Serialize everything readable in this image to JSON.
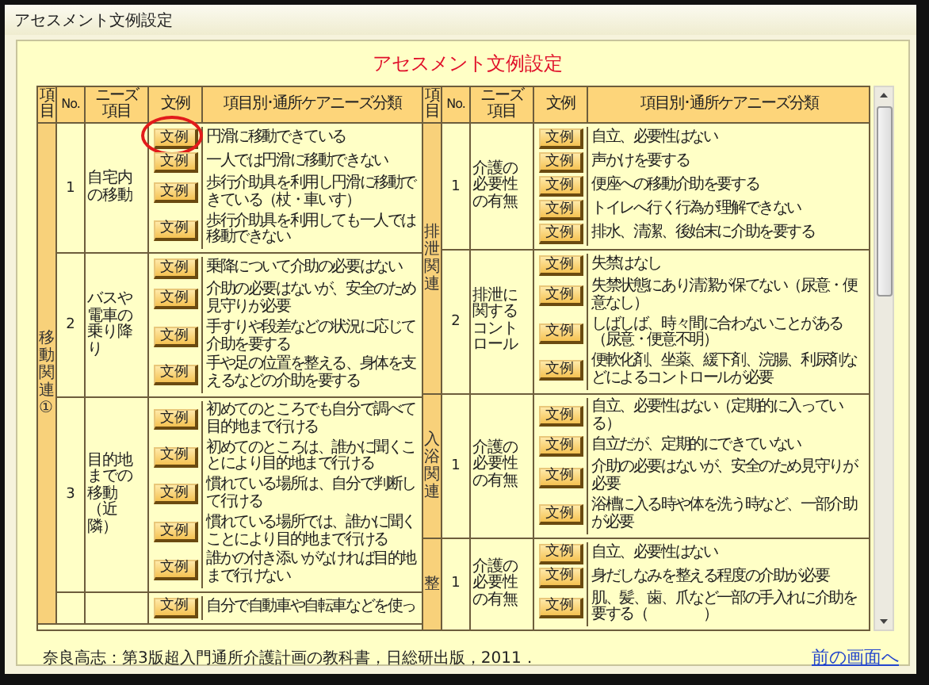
{
  "window": {
    "title": "アセスメント文例設定"
  },
  "heading": "アセスメント文例設定",
  "header_left": [
    "項目",
    "No.",
    "ニーズ項目",
    "文例",
    "項目別･通所ケアニーズ分類"
  ],
  "header_right": [
    "項目",
    "No.",
    "ニーズ項目",
    "文例",
    "項目別･通所ケアニーズ分類"
  ],
  "left": [
    {
      "label": "移動関連①",
      "groups": [
        {
          "no": "1",
          "need": "自宅内の移動",
          "items": [
            {
              "button": "文例",
              "text": "円滑に移動できている",
              "circled": true
            },
            {
              "button": "文例",
              "text": "一人では円滑に移動できない",
              "circled": false
            },
            {
              "button": "文例",
              "text": "歩行介助具を利用し円滑に移動できている（杖・車いす）",
              "circled": false
            },
            {
              "button": "文例",
              "text": "歩行介助具を利用しても一人では移動できない",
              "circled": false
            }
          ]
        },
        {
          "no": "2",
          "need": "バスや電車の乗り降り",
          "items": [
            {
              "button": "文例",
              "text": "乗降について介助の必要はない",
              "circled": false
            },
            {
              "button": "文例",
              "text": "介助の必要はないが、安全のため見守りが必要",
              "circled": false
            },
            {
              "button": "文例",
              "text": "手すりや段差などの状況に応じて介助を要する",
              "circled": false
            },
            {
              "button": "文例",
              "text": "手や足の位置を整える、身体を支えるなどの介助を要する",
              "circled": false
            }
          ]
        },
        {
          "no": "3",
          "need": "目的地までの移動（近隣）",
          "items": [
            {
              "button": "文例",
              "text": "初めてのところでも自分で調べて目的地まで行ける",
              "circled": false
            },
            {
              "button": "文例",
              "text": "初めてのところは、誰かに聞くことにより目的地まで行ける",
              "circled": false
            },
            {
              "button": "文例",
              "text": "慣れている場所は、自分で判断して行ける",
              "circled": false
            },
            {
              "button": "文例",
              "text": "慣れている場所では、誰かに聞くことにより目的地まで行ける",
              "circled": false
            },
            {
              "button": "文例",
              "text": "誰かの付き添いがなければ目的地まで行けない",
              "circled": false
            }
          ]
        },
        {
          "items": [
            {
              "button": "文例",
              "text": "自分で自動車や自転車などを使っ",
              "circled": false
            }
          ]
        }
      ]
    }
  ],
  "right": [
    {
      "label": "排泄関連",
      "groups": [
        {
          "no": "1",
          "need": "介護の必要性の有無",
          "items": [
            {
              "button": "文例",
              "text": "自立、必要性はない",
              "circled": false
            },
            {
              "button": "文例",
              "text": "声かけを要する",
              "circled": false
            },
            {
              "button": "文例",
              "text": "便座への移動介助を要する",
              "circled": false
            },
            {
              "button": "文例",
              "text": "トイレへ行く行為が理解できない",
              "circled": false
            },
            {
              "button": "文例",
              "text": "排水、清潔、後始末に介助を要する",
              "circled": false
            }
          ]
        },
        {
          "no": "2",
          "need": "排泄に関するコントロール",
          "items": [
            {
              "button": "文例",
              "text": "失禁はなし",
              "circled": false
            },
            {
              "button": "文例",
              "text": "失禁状態にあり清潔が保てない（尿意・便意なし）",
              "circled": false
            },
            {
              "button": "文例",
              "text": "しばしば、時々間に合わないことがある（尿意・便意不明）",
              "circled": false
            },
            {
              "button": "文例",
              "text": "便軟化剤、坐薬、緩下剤、浣腸、利尿剤などによるコントロールが必要",
              "circled": false
            }
          ]
        }
      ]
    },
    {
      "label": "入浴関連",
      "groups": [
        {
          "no": "1",
          "need": "介護の必要性の有無",
          "items": [
            {
              "button": "文例",
              "text": "自立、必要性はない（定期的に入っている）",
              "circled": false
            },
            {
              "button": "文例",
              "text": "自立だが、定期的にできていない",
              "circled": false
            },
            {
              "button": "文例",
              "text": "介助の必要はないが、安全のため見守りが必要",
              "circled": false
            },
            {
              "button": "文例",
              "text": "浴槽に入る時や体を洗う時など、一部介助が必要",
              "circled": false
            }
          ]
        }
      ]
    },
    {
      "label": "整",
      "groups": [
        {
          "no": "1",
          "need": "介護の必要性の有無",
          "items": [
            {
              "button": "文例",
              "text": "自立、必要性はない",
              "circled": false
            },
            {
              "button": "文例",
              "text": "身だしなみを整える程度の介助が必要",
              "circled": false
            },
            {
              "button": "文例",
              "text": "肌、髪、歯、爪など一部の手入れに介助を要する（　　　　）",
              "circled": false
            }
          ]
        }
      ]
    }
  ],
  "citation": "奈良高志：第3版超入門通所介護計画の教科書，日総研出版，2011．",
  "back_link": "前の画面へ"
}
